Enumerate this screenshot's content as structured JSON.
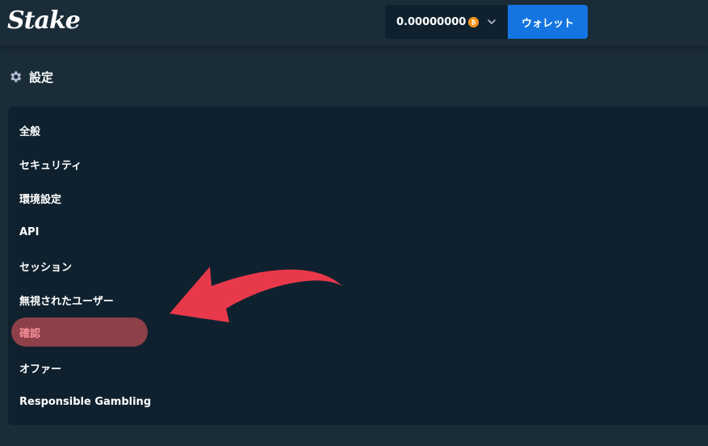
{
  "header": {
    "logo": "Stake",
    "balance": "0.00000000",
    "currency_icon": "bitcoin-icon",
    "wallet_label": "ウォレット"
  },
  "page": {
    "title": "設定",
    "title_icon": "gear-icon"
  },
  "menu": {
    "items": [
      {
        "label": "全般",
        "active": false
      },
      {
        "label": "セキュリティ",
        "active": false
      },
      {
        "label": "環境設定",
        "active": false
      },
      {
        "label": "API",
        "active": false
      },
      {
        "label": "セッション",
        "active": false
      },
      {
        "label": "無視されたユーザー",
        "active": false
      },
      {
        "label": "確認",
        "active": true
      },
      {
        "label": "オファー",
        "active": false
      },
      {
        "label": "Responsible Gambling",
        "active": false
      }
    ]
  },
  "colors": {
    "background": "#1a2c38",
    "panel": "#0f212e",
    "wallet_button": "#1475e1",
    "active_item_bg": "#8e4049",
    "active_item_text": "#f38e96",
    "annotation_arrow": "#e8394a",
    "bitcoin": "#f7931a"
  }
}
